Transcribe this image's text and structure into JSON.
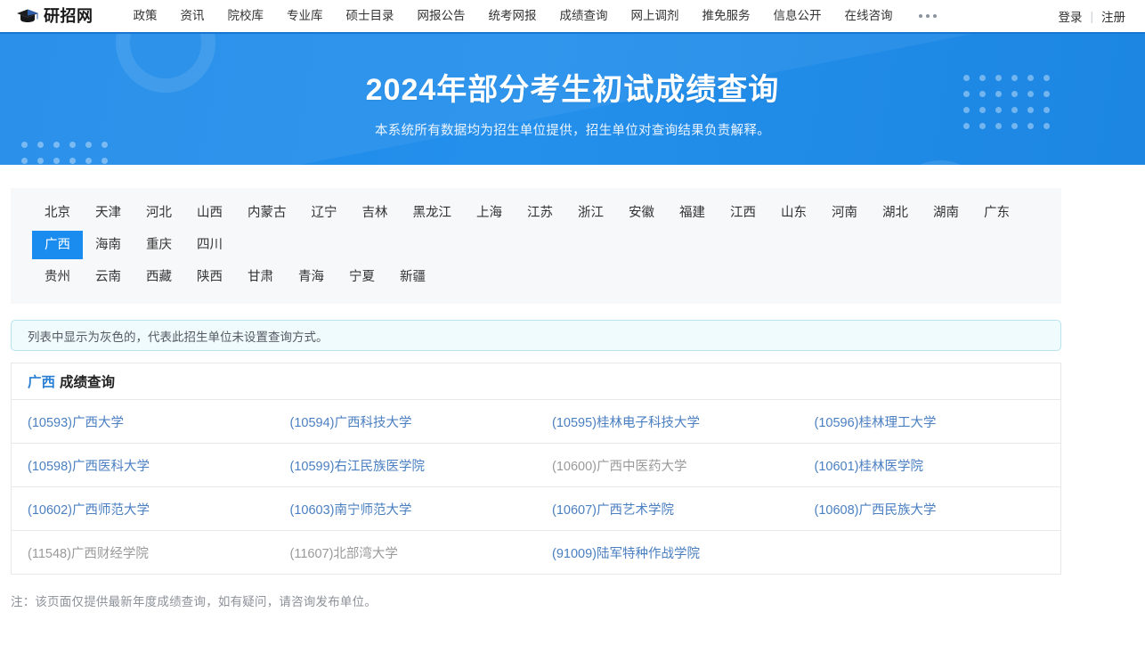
{
  "header": {
    "logo_text": "研招网",
    "logo_icon": "graduation-cap-icon",
    "nav": [
      "政策",
      "资讯",
      "院校库",
      "专业库",
      "硕士目录",
      "网报公告",
      "统考网报",
      "成绩查询",
      "网上调剂",
      "推免服务",
      "信息公开",
      "在线咨询"
    ],
    "more_icon": "ellipsis-icon",
    "login_label": "登录",
    "separator": "|",
    "register_label": "注册"
  },
  "banner": {
    "title": "2024年部分考生初试成绩查询",
    "subtitle": "本系统所有数据均为招生单位提供，招生单位对查询结果负责解释。",
    "bg_color": "#1e8ae8"
  },
  "provinces": {
    "selected": "广西",
    "row1": [
      "北京",
      "天津",
      "河北",
      "山西",
      "内蒙古",
      "辽宁",
      "吉林",
      "黑龙江",
      "上海",
      "江苏",
      "浙江",
      "安徽",
      "福建",
      "江西",
      "山东",
      "河南",
      "湖北",
      "湖南",
      "广东",
      "广西",
      "海南",
      "重庆",
      "四川"
    ],
    "row2": [
      "贵州",
      "云南",
      "西藏",
      "陕西",
      "甘肃",
      "青海",
      "宁夏",
      "新疆"
    ],
    "active_color": "#1a8cf0"
  },
  "notice": {
    "text": "列表中显示为灰色的，代表此招生单位未设置查询方式。"
  },
  "results": {
    "title_highlight": "广西",
    "title_rest": "成绩查询",
    "link_color": "#4a7fc1",
    "disabled_color": "#9a9a9a",
    "rows": [
      [
        {
          "label": "(10593)广西大学",
          "disabled": false
        },
        {
          "label": "(10594)广西科技大学",
          "disabled": false
        },
        {
          "label": "(10595)桂林电子科技大学",
          "disabled": false
        },
        {
          "label": "(10596)桂林理工大学",
          "disabled": false
        }
      ],
      [
        {
          "label": "(10598)广西医科大学",
          "disabled": false
        },
        {
          "label": "(10599)右江民族医学院",
          "disabled": false
        },
        {
          "label": "(10600)广西中医药大学",
          "disabled": true
        },
        {
          "label": "(10601)桂林医学院",
          "disabled": false
        }
      ],
      [
        {
          "label": "(10602)广西师范大学",
          "disabled": false
        },
        {
          "label": "(10603)南宁师范大学",
          "disabled": false
        },
        {
          "label": "(10607)广西艺术学院",
          "disabled": false
        },
        {
          "label": "(10608)广西民族大学",
          "disabled": false
        }
      ],
      [
        {
          "label": "(11548)广西财经学院",
          "disabled": true
        },
        {
          "label": "(11607)北部湾大学",
          "disabled": true
        },
        {
          "label": "(91009)陆军特种作战学院",
          "disabled": false
        },
        {
          "label": "",
          "disabled": false
        }
      ]
    ]
  },
  "footnote": {
    "text": "注：该页面仅提供最新年度成绩查询，如有疑问，请咨询发布单位。"
  }
}
